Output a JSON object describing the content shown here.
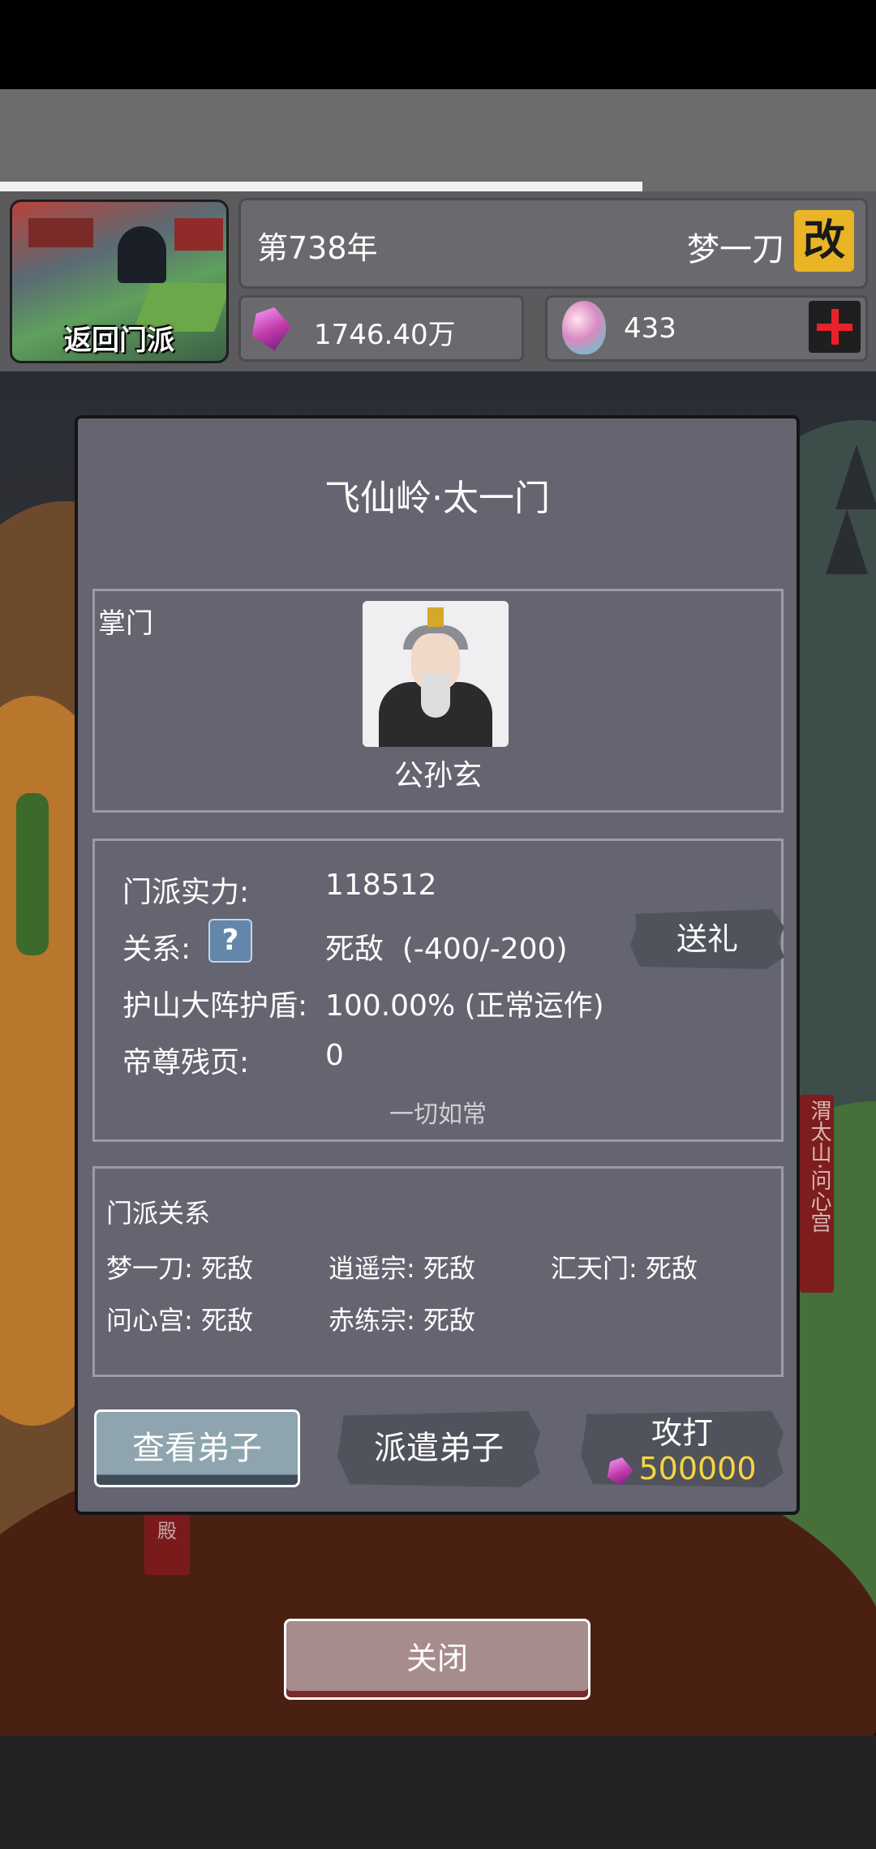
{
  "hud": {
    "return_label": "返回门派",
    "year": "第738年",
    "player_name": "梦一刀",
    "rename_label": "改",
    "spirit_stones": "1746.40万",
    "eggs": "433"
  },
  "dialog": {
    "title": "飞仙岭·太一门",
    "leader_label": "掌门",
    "leader_name": "公孙玄",
    "info": {
      "power_label": "门派实力:",
      "power_value": "118512",
      "relation_label": "关系:",
      "relation_value": "死敌  (-400/-200)",
      "shield_label": "护山大阵护盾:",
      "shield_value": "100.00% (正常运作)",
      "pages_label": "帝尊残页:",
      "pages_value": "0",
      "status": "一切如常",
      "gift_label": "送礼"
    },
    "relations": {
      "title": "门派关系",
      "items": [
        "梦一刀: 死敌",
        "逍遥宗: 死敌",
        "汇天门: 死敌",
        "问心宫: 死敌",
        "赤练宗: 死敌"
      ]
    },
    "actions": {
      "view": "查看弟子",
      "send": "派遣弟子",
      "attack": "攻打",
      "attack_cost": "500000"
    }
  },
  "scene": {
    "side_tag": "渭太山·问心宫",
    "hall_tag": "殿"
  },
  "close_label": "关闭"
}
